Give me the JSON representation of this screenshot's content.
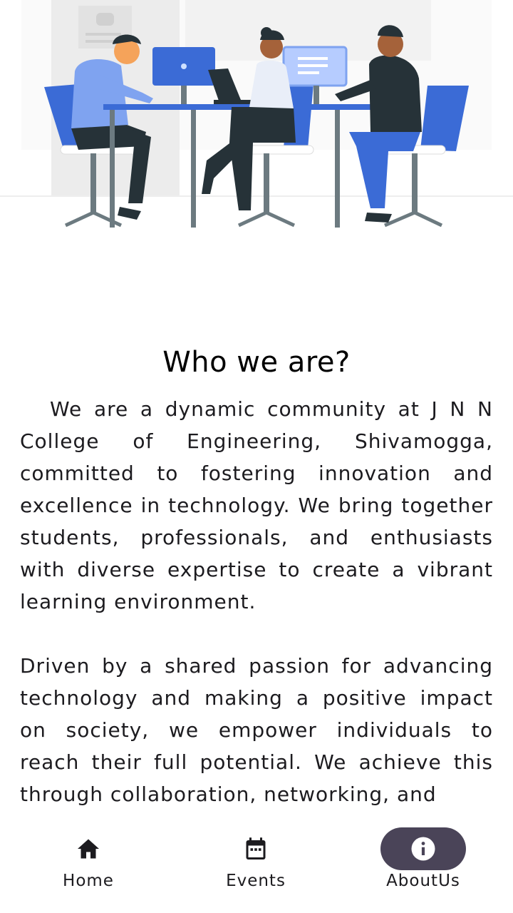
{
  "about": {
    "heading": "Who we are?",
    "paragraph1": "We are a dynamic community at J N N College of Engineering, Shivamogga, committed to fostering innovation and excellence in technology. We bring together students, professionals, and enthusiasts with diverse expertise to create a vibrant learning environment.",
    "paragraph2": "Driven by a shared passion for advancing technology and making a positive impact on society, we empower individuals to reach their full potential. We achieve this through collaboration, networking, and"
  },
  "nav": {
    "items": [
      {
        "label": "Home",
        "icon": "home-icon",
        "active": false
      },
      {
        "label": "Events",
        "icon": "calendar-icon",
        "active": false
      },
      {
        "label": "AboutUs",
        "icon": "info-icon",
        "active": true
      }
    ],
    "active_indicator_color": "#4a4458"
  },
  "colors": {
    "accent_blue": "#3b6bd6",
    "dark": "#263238"
  }
}
